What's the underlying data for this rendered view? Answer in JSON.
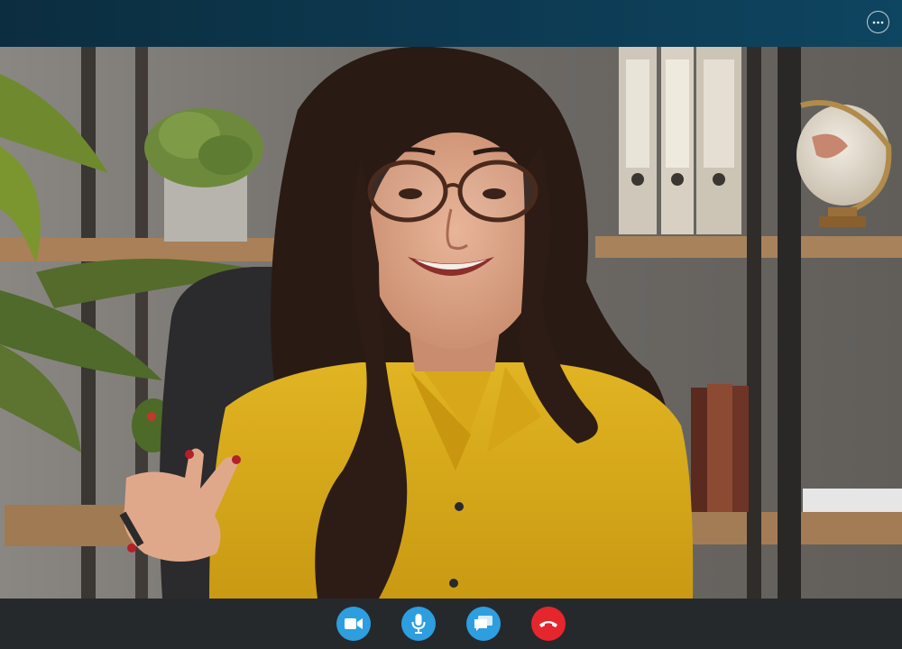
{
  "app": {
    "colors": {
      "topbar": "#0d3a52",
      "control_blue": "#2d9ee0",
      "end_call_red": "#e5262c",
      "control_bar": "#26292c"
    }
  },
  "header": {
    "more_icon": "ellipsis-icon"
  },
  "video": {
    "description_hidden": true
  },
  "controls": [
    {
      "name": "video",
      "icon": "video-camera-icon",
      "color": "#2d9ee0"
    },
    {
      "name": "microphone",
      "icon": "microphone-icon",
      "color": "#2d9ee0"
    },
    {
      "name": "chat",
      "icon": "chat-icon",
      "color": "#2d9ee0"
    },
    {
      "name": "end-call",
      "icon": "phone-hangup-icon",
      "color": "#e5262c"
    }
  ]
}
